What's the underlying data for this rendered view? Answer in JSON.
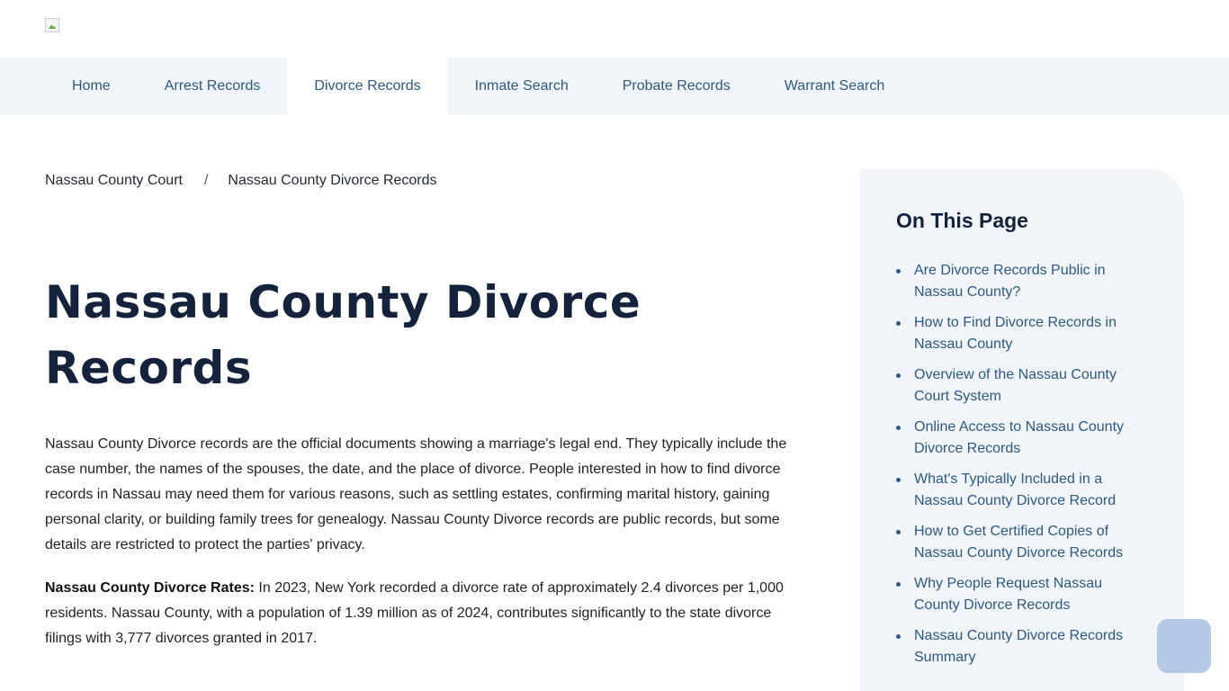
{
  "nav": {
    "items": [
      "Home",
      "Arrest Records",
      "Divorce Records",
      "Inmate Search",
      "Probate Records",
      "Warrant Search"
    ],
    "active": "Divorce Records"
  },
  "breadcrumb": {
    "parent": "Nassau County Court",
    "separator": "/",
    "current": "Nassau County Divorce Records"
  },
  "title": "Nassau County Divorce Records",
  "intro": "Nassau County Divorce records are the official documents showing a marriage's legal end. They typically include the case number, the names of the spouses, the date, and the place of divorce. People interested in how to find divorce records in Nassau may need them for various reasons, such as settling estates, confirming marital history, gaining personal clarity, or building family trees for genealogy. Nassau County Divorce records are public records, but some details are restricted to protect the parties' privacy.",
  "rates": {
    "label": "Nassau County Divorce Rates:",
    "text": " In 2023, New York recorded a divorce rate of approximately 2.4 divorces per 1,000 residents. Nassau County, with a population of 1.39 million as of 2024, contributes significantly to the state divorce filings with 3,777 divorces granted in 2017."
  },
  "toc": {
    "title": "On This Page",
    "items": [
      "Are Divorce Records Public in Nassau County?",
      "How to Find Divorce Records in Nassau County",
      "Overview of the Nassau County Court System",
      "Online Access to Nassau County Divorce Records",
      "What's Typically Included in a Nassau County Divorce Record",
      "How to Get Certified Copies of Nassau County Divorce Records",
      "Why People Request Nassau County Divorce Records",
      "Nassau County Divorce Records Summary"
    ]
  },
  "colors": {
    "nav_bg": "#f1f4f8",
    "link": "#2c5a84",
    "heading": "#14233b",
    "float_button": "#b4c9e5"
  },
  "icons": {
    "logo": "broken-image-icon"
  }
}
